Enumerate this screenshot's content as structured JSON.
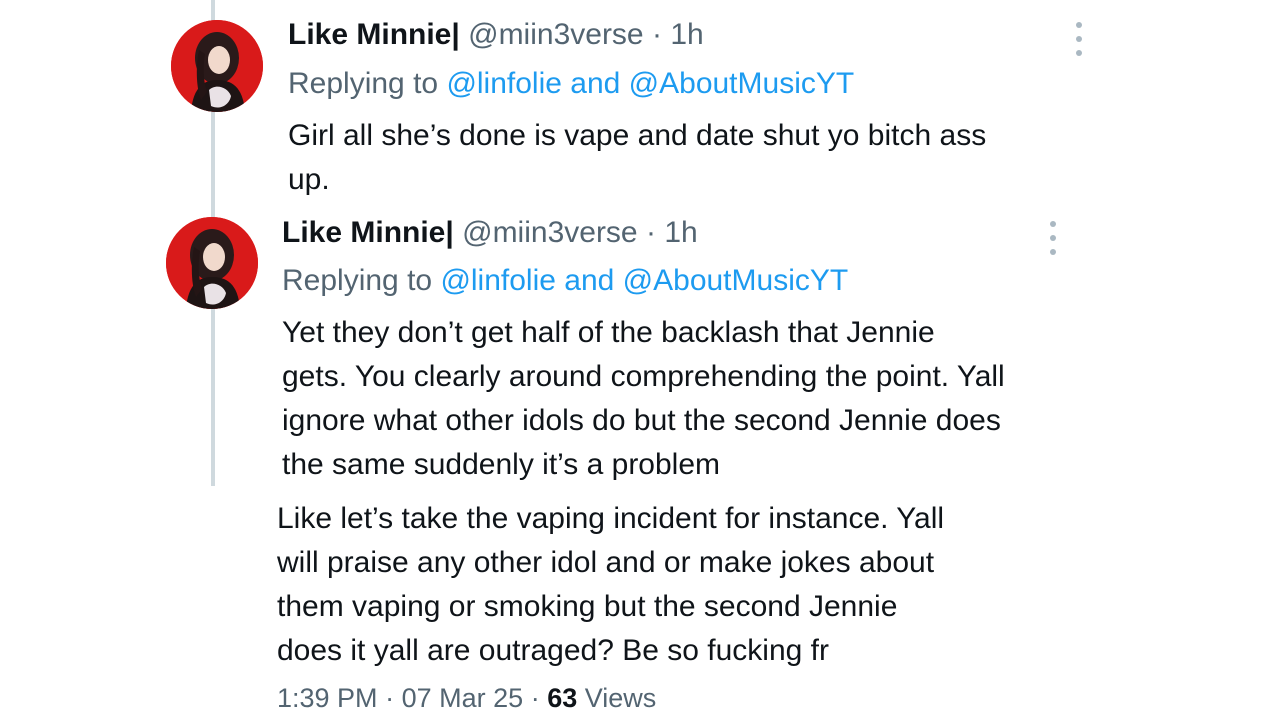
{
  "colors": {
    "text_primary": "#0f1419",
    "text_secondary": "#536471",
    "mention": "#1d9bf0",
    "thread_line": "#cfd9de",
    "avatar_background": "#e02020"
  },
  "tweets": [
    {
      "display_name": "Like Minnie|",
      "handle": "@miin3verse",
      "separator": "·",
      "time": "1h",
      "replying_prefix": "Replying to",
      "replying_mentions": "@linfolie and @AboutMusicYT",
      "text_lines": [
        "Girl all she’s done is vape and date shut yo bitch ass",
        "up."
      ],
      "more_icon": "more-vertical-icon",
      "avatar_icon": "profile-avatar"
    },
    {
      "display_name": "Like Minnie|",
      "handle": "@miin3verse",
      "separator": "·",
      "time": "1h",
      "replying_prefix": "Replying to",
      "replying_mentions": "@linfolie and @AboutMusicYT",
      "text_lines": [
        "Yet they don’t get half of the backlash that Jennie",
        "gets. You clearly around comprehending the point. Yall",
        "ignore what other idols do but the second Jennie does",
        "the same suddenly it’s a problem"
      ],
      "more_icon": "more-vertical-icon",
      "avatar_icon": "profile-avatar"
    }
  ],
  "main_tweet": {
    "text_lines": [
      "Like let’s take the vaping incident for instance. Yall",
      "will praise any other idol and or make jokes about",
      "them vaping or smoking but the second Jennie",
      "does it yall are outraged? Be so fucking fr"
    ],
    "time": "1:39 PM",
    "sep1": "·",
    "date": "07 Mar 25",
    "sep2": "·",
    "views_count": "63",
    "views_label": "Views"
  }
}
